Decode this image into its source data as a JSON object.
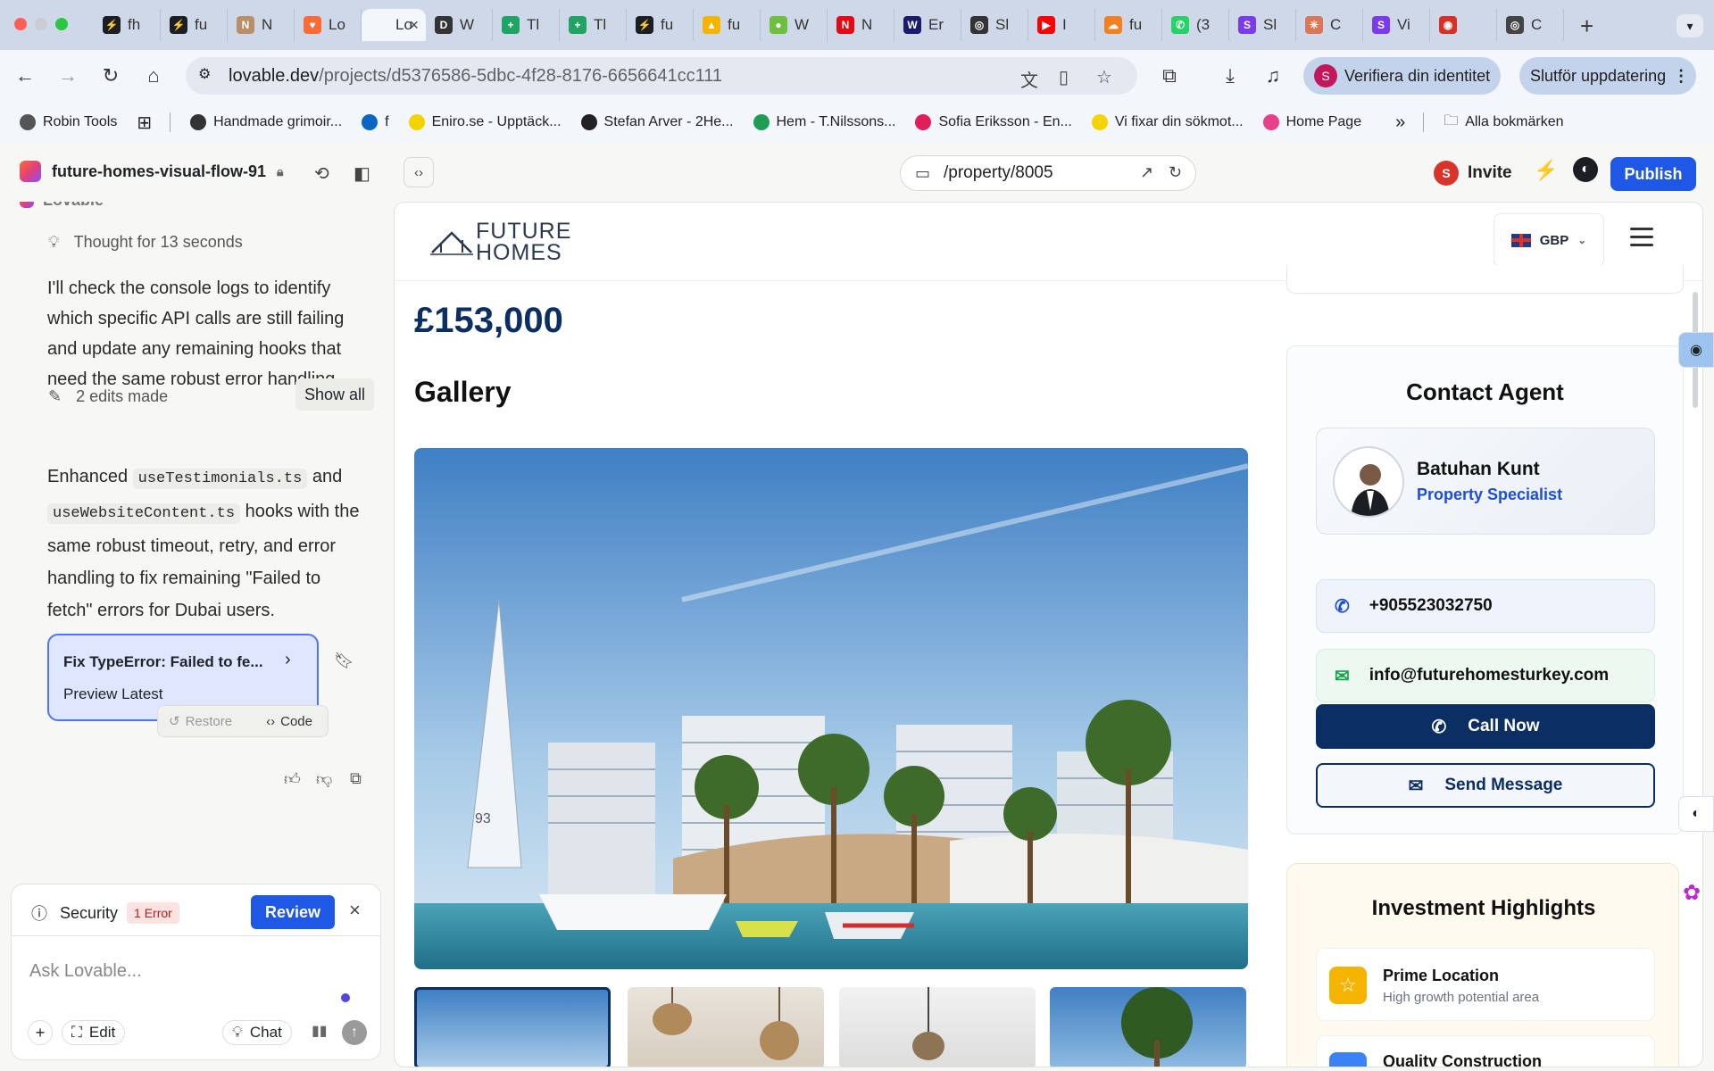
{
  "browser": {
    "tabs": [
      {
        "label": "fh",
        "color": "#1b1f24",
        "glyph": "⚡"
      },
      {
        "label": "fu",
        "color": "#1b1f24",
        "glyph": "⚡"
      },
      {
        "label": "N",
        "color": "#b98f6a",
        "glyph": "N"
      },
      {
        "label": "Lo",
        "color": "#ff6b35",
        "glyph": "♥"
      },
      {
        "label": "Lo",
        "color": "#f3f6fb",
        "glyph": "",
        "active": true
      },
      {
        "label": "W",
        "color": "#333333",
        "glyph": "D"
      },
      {
        "label": "Tl",
        "color": "#1fa463",
        "glyph": "+"
      },
      {
        "label": "Tl",
        "color": "#1fa463",
        "glyph": "+"
      },
      {
        "label": "fu",
        "color": "#1b1f24",
        "glyph": "⚡"
      },
      {
        "label": "fu",
        "color": "#f4b400",
        "glyph": "▲"
      },
      {
        "label": "W",
        "color": "#6cbf3f",
        "glyph": "●"
      },
      {
        "label": "N",
        "color": "#e50914",
        "glyph": "N"
      },
      {
        "label": "Er",
        "color": "#1a1a6e",
        "glyph": "W"
      },
      {
        "label": "Sl",
        "color": "#333333",
        "glyph": "◎"
      },
      {
        "label": "I",
        "color": "#ff0000",
        "glyph": "▶"
      },
      {
        "label": "fu",
        "color": "#f38020",
        "glyph": "☁"
      },
      {
        "label": "(3",
        "color": "#25d366",
        "glyph": "✆"
      },
      {
        "label": "Sl",
        "color": "#7c3aed",
        "glyph": "S"
      },
      {
        "label": "C",
        "color": "#d97757",
        "glyph": "✳"
      },
      {
        "label": "Vi",
        "color": "#7c3aed",
        "glyph": "S"
      },
      {
        "label": "",
        "color": "#d93025",
        "glyph": "◉"
      },
      {
        "label": "C",
        "color": "#444444",
        "glyph": "◎"
      }
    ],
    "active_tab_close": "×",
    "new_tab": "+",
    "url_domain": "lovable.dev",
    "url_path": "/projects/d5376586-5dbc-4f28-8176-6656641cc111",
    "verify_pill": "Verifiera din identitet",
    "verify_avatar": "S",
    "update_pill": "Slutför uppdatering",
    "bookmarks": [
      {
        "label": "Robin Tools",
        "color": "#555555"
      },
      {
        "label": "Handmade grimoir...",
        "color": "#333333"
      },
      {
        "label": "f",
        "color": "#0a66c2"
      },
      {
        "label": "Eniro.se - Upptäck...",
        "color": "#f5d300"
      },
      {
        "label": "Stefan Arver - 2He...",
        "color": "#222222"
      },
      {
        "label": "Hem - T.Nilssons...",
        "color": "#1f9d55"
      },
      {
        "label": "Sofia Eriksson - En...",
        "color": "#e01e5a"
      },
      {
        "label": "Vi fixar din sökmot...",
        "color": "#f5d300"
      },
      {
        "label": "Home Page",
        "color": "#e83e8c"
      }
    ],
    "bookmarks_more": "»",
    "all_bookmarks": "Alla bokmärken"
  },
  "lovable": {
    "project_name": "future-homes-visual-flow-91",
    "preview_path": "/property/8005",
    "invite_label": "Invite",
    "invite_avatar": "S",
    "publish_label": "Publish",
    "cut_heading": "Lovable",
    "thought": "Thought for 13 seconds",
    "message1": "I'll check the console logs to identify which specific API calls are still failing and update any remaining hooks that need the same robust error handling.",
    "edits_made": "2 edits made",
    "show_all": "Show all",
    "enh_text1": "Enhanced",
    "enh_code1": "useTestimonials.ts",
    "enh_and": "and",
    "enh_code2": "useWebsiteContent.ts",
    "enh_text2": "hooks with the same robust timeout, retry, and error handling to fix remaining \"Failed to fetch\" errors for Dubai users.",
    "fix_title": "Fix TypeError: Failed to fe...",
    "fix_sub": "Preview Latest",
    "restore": "Restore",
    "code": "Code",
    "security_label": "Security",
    "security_badge": "1 Error",
    "review": "Review",
    "ask_placeholder": "Ask Lovable...",
    "edit_label": "Edit",
    "chat_label": "Chat"
  },
  "site": {
    "logo_line1": "FUTURE",
    "logo_line2": "HOMES",
    "currency": "GBP",
    "price": "£153,000",
    "gallery_title": "Gallery",
    "image_number": "93",
    "contact_title": "Contact Agent",
    "agent_name": "Batuhan Kunt",
    "agent_role": "Property Specialist",
    "phone": "+905523032750",
    "email": "info@futurehomesturkey.com",
    "call_now": "Call Now",
    "send_message": "Send Message",
    "invest_title": "Investment Highlights",
    "highlights": [
      {
        "title": "Prime Location",
        "subtitle": "High growth potential area",
        "color": "#f5b400"
      },
      {
        "title": "Quality Construction",
        "subtitle": "",
        "color": "#3b82f6"
      }
    ]
  },
  "colors": {
    "brand_navy": "#0b2e63",
    "lovable_blue": "#1f57e6",
    "error_red": "#d9342b"
  }
}
